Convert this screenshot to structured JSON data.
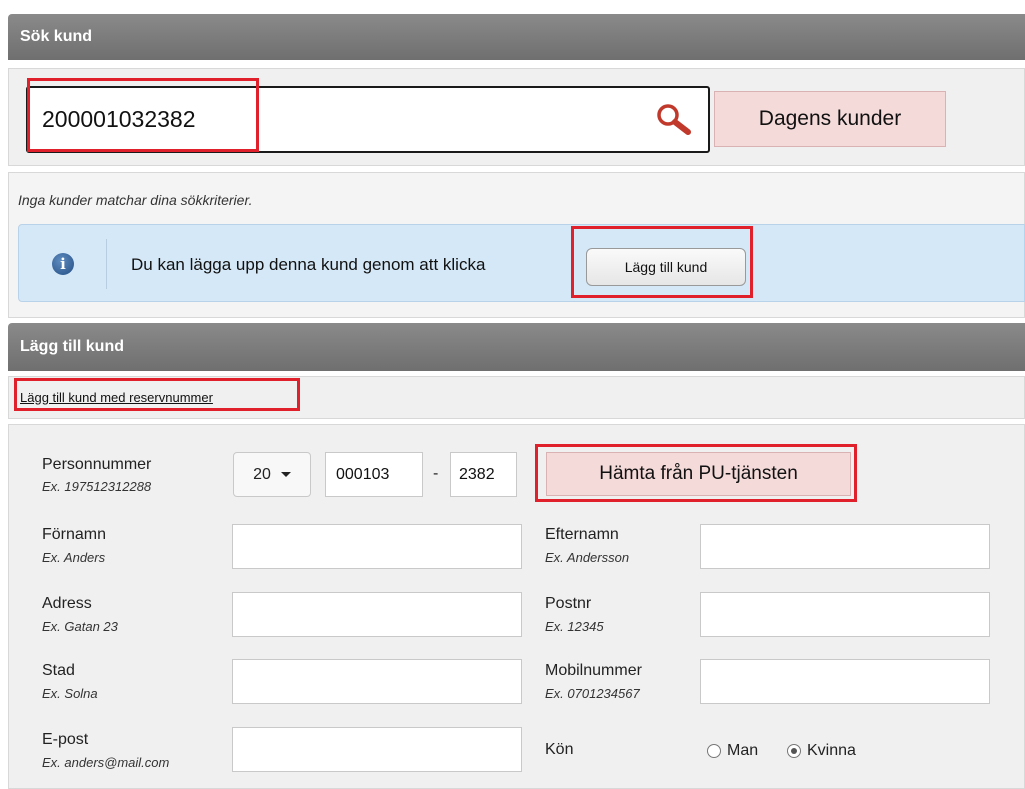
{
  "search_section": {
    "title": "Sök kund",
    "search_value": "200001032382",
    "todays_customers_label": "Dagens kunder"
  },
  "result": {
    "no_match_text": "Inga kunder matchar dina sökkriterier.",
    "info_text": "Du kan lägga upp denna kund genom att klicka",
    "add_customer_button": "Lägg till kund"
  },
  "add_section": {
    "title": "Lägg till kund",
    "reserve_link": "Lägg till kund med reservnummer"
  },
  "form": {
    "personnummer": {
      "label": "Personnummer",
      "example": "Ex. 197512312288",
      "century": "20",
      "date_part": "000103",
      "dash": "-",
      "last_part": "2382"
    },
    "fetch_button": "Hämta från PU-tjänsten",
    "fornamn": {
      "label": "Förnamn",
      "example": "Ex. Anders",
      "value": ""
    },
    "efternamn": {
      "label": "Efternamn",
      "example": "Ex. Andersson",
      "value": ""
    },
    "adress": {
      "label": "Adress",
      "example": "Ex. Gatan 23",
      "value": ""
    },
    "postnr": {
      "label": "Postnr",
      "example": "Ex. 12345",
      "value": ""
    },
    "stad": {
      "label": "Stad",
      "example": "Ex. Solna",
      "value": ""
    },
    "mobil": {
      "label": "Mobilnummer",
      "example": "Ex. 0701234567",
      "value": ""
    },
    "epost": {
      "label": "E-post",
      "example": "Ex. anders@mail.com",
      "value": ""
    },
    "kon": {
      "label": "Kön",
      "options": [
        "Man",
        "Kvinna"
      ],
      "selected": "Kvinna"
    }
  },
  "colors": {
    "header_bg": "#7c7c7c",
    "highlight_red": "#e0202a",
    "pink_button": "#f5dada",
    "info_bg": "#d5e8f7"
  }
}
